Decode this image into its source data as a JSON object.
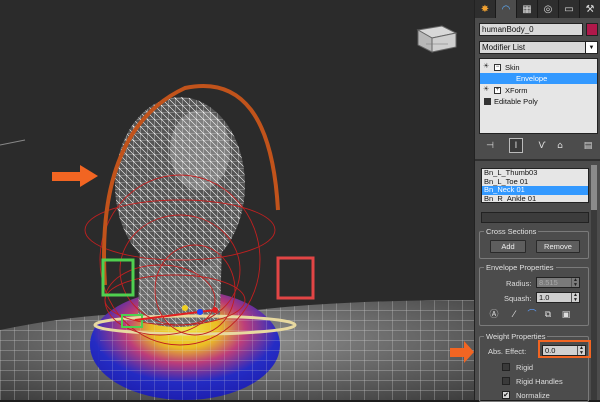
{
  "panel": {
    "tabs": [
      {
        "icon": "sun-icon",
        "glyph": "✸"
      },
      {
        "icon": "modify-icon",
        "glyph": "◠"
      },
      {
        "icon": "hierarchy-icon",
        "glyph": "▦"
      },
      {
        "icon": "motion-icon",
        "glyph": "◎"
      },
      {
        "icon": "display-icon",
        "glyph": "▭"
      },
      {
        "icon": "utilities-icon",
        "glyph": "⚒"
      }
    ],
    "object_name": "humanBody_0",
    "object_color": "#b0184a",
    "modifier_list_label": "Modifier List",
    "stack": [
      {
        "label": "Skin",
        "indent": 0,
        "expand": "−",
        "selected": false
      },
      {
        "label": "Envelope",
        "indent": 1,
        "expand": "",
        "selected": true
      },
      {
        "label": "XForm",
        "indent": 0,
        "expand": "+",
        "selected": false
      },
      {
        "label": "Editable Poly",
        "indent": 0,
        "expand": "",
        "selected": false
      }
    ],
    "bones": [
      "Bn_L_Thumb03",
      "Bn_L_Toe 01",
      "Bn_Neck 01",
      "Bn_R_Ankle 01"
    ],
    "selected_bone_index": 2,
    "cross_sections": {
      "title": "Cross Sections",
      "add_label": "Add",
      "remove_label": "Remove"
    },
    "envelope_properties": {
      "title": "Envelope Properties",
      "radius_label": "Radius:",
      "radius_value": "8.515",
      "squash_label": "Squash:",
      "squash_value": "1.0"
    },
    "weight_properties": {
      "title": "Weight Properties",
      "abs_effect_label": "Abs. Effect:",
      "abs_effect_value": "0.0",
      "rigid_label": "Rigid",
      "rigid_checked": false,
      "rigid_handles_label": "Rigid Handles",
      "rigid_handles_checked": false,
      "normalize_label": "Normalize",
      "normalize_checked": true
    }
  },
  "viewport": {
    "annotation_color": "#f26522"
  }
}
